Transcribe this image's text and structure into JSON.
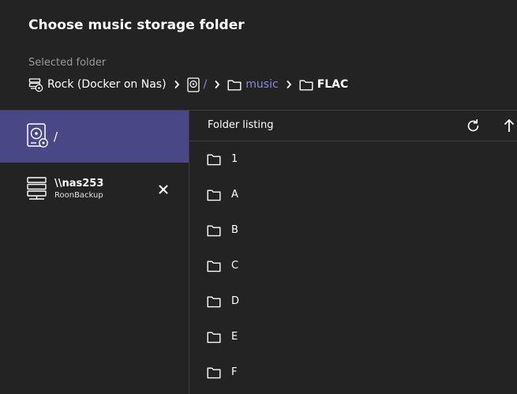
{
  "dialog": {
    "title": "Choose music storage folder"
  },
  "selected": {
    "label": "Selected folder",
    "breadcrumb": [
      {
        "label": "Rock (Docker on Nas)",
        "icon": "server-core-icon"
      },
      {
        "label": "/",
        "icon": "drive-icon"
      },
      {
        "label": "music",
        "icon": "folder-icon"
      },
      {
        "label": "FLAC",
        "icon": "folder-icon"
      }
    ]
  },
  "locations": {
    "root": {
      "label": "/",
      "icon": "drive-icon"
    },
    "network": {
      "name": "\\\\nas253",
      "sub": "RoonBackup",
      "icon": "server-icon",
      "remove_icon": "close-icon"
    }
  },
  "listing": {
    "title": "Folder listing",
    "refresh_icon": "refresh-icon",
    "up_icon": "arrow-up-icon",
    "folders": [
      "1",
      "A",
      "B",
      "C",
      "D",
      "E",
      "F"
    ]
  },
  "colors": {
    "background": "#232323",
    "selected_location": "#4a4786",
    "link": "#8b86e6",
    "muted_text": "#9a9a9a",
    "divider": "#3c3c3c"
  }
}
